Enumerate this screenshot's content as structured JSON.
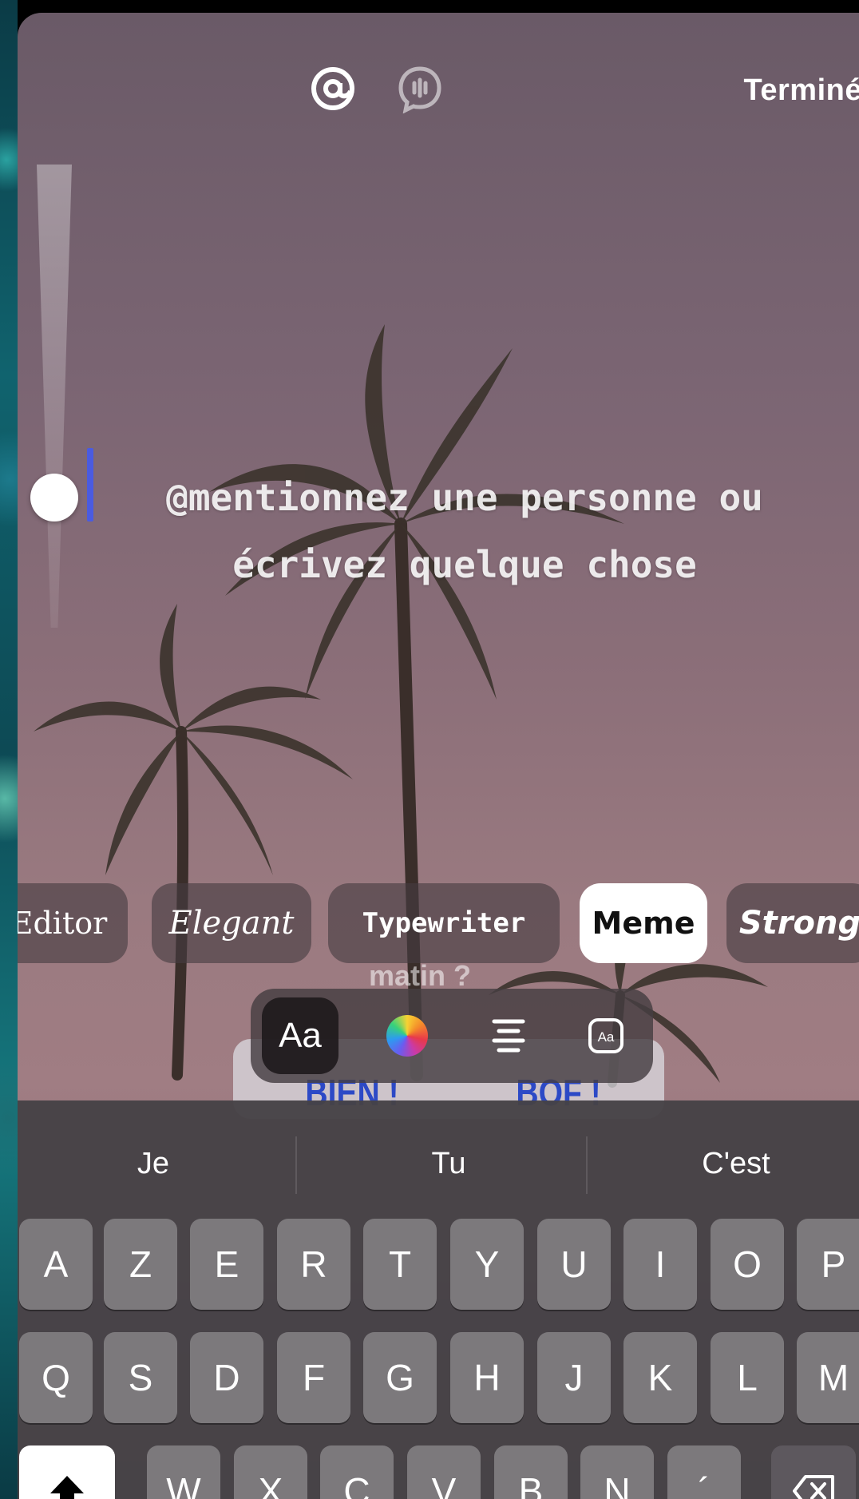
{
  "top_bar": {
    "mention_icon": "at-sign-icon",
    "audio_icon": "audio-bubble-icon",
    "done_label": "Terminé"
  },
  "editor": {
    "placeholder_line1": "@mentionnez une personne ou",
    "placeholder_line2": "écrivez quelque chose"
  },
  "font_styles": {
    "editor": "Editor",
    "elegant": "Elegant",
    "typewriter": "Typewriter",
    "meme": "Meme",
    "strong": "Strong",
    "selected": "Meme"
  },
  "tools": {
    "font_size_label": "Aa",
    "color_icon": "color-wheel-icon",
    "align_icon": "align-center-icon",
    "background_icon": "text-background-icon"
  },
  "background_sticker": {
    "question": "matin ?",
    "option_1": "BIEN !",
    "option_2": "BOF !"
  },
  "keyboard": {
    "suggestions": [
      "Je",
      "Tu",
      "C'est"
    ],
    "row1": [
      "A",
      "Z",
      "E",
      "R",
      "T",
      "Y",
      "U",
      "I",
      "O",
      "P"
    ],
    "row2": [
      "Q",
      "S",
      "D",
      "F",
      "G",
      "H",
      "J",
      "K",
      "L",
      "M"
    ],
    "row3": [
      "W",
      "X",
      "C",
      "V",
      "B",
      "N",
      "´"
    ],
    "shift_icon": "shift-arrow-icon",
    "delete_icon": "backspace-icon"
  },
  "colors": {
    "cursor": "#4a5be0",
    "poll_text": "#2c49c6",
    "selected_chip": "#ffffff"
  }
}
